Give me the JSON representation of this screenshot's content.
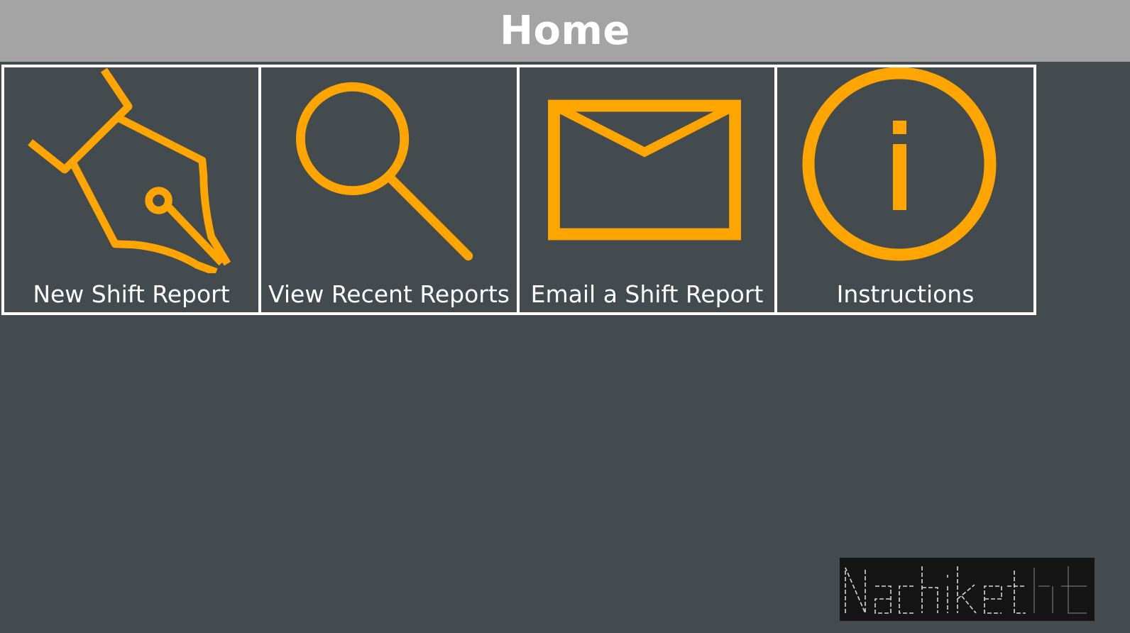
{
  "header": {
    "title": "Home"
  },
  "tiles": [
    {
      "label": "New Shift Report",
      "icon": "pen-nib-icon"
    },
    {
      "label": "View Recent Reports",
      "icon": "search-icon"
    },
    {
      "label": "Email a Shift Report",
      "icon": "envelope-icon"
    },
    {
      "label": "Instructions",
      "icon": "info-icon"
    }
  ],
  "colors": {
    "header_bg": "#a4a4a4",
    "page_bg": "#434b4e",
    "icon_accent": "#ffa500",
    "border": "#ffffff"
  },
  "logo": {
    "text": "Nachiket"
  }
}
